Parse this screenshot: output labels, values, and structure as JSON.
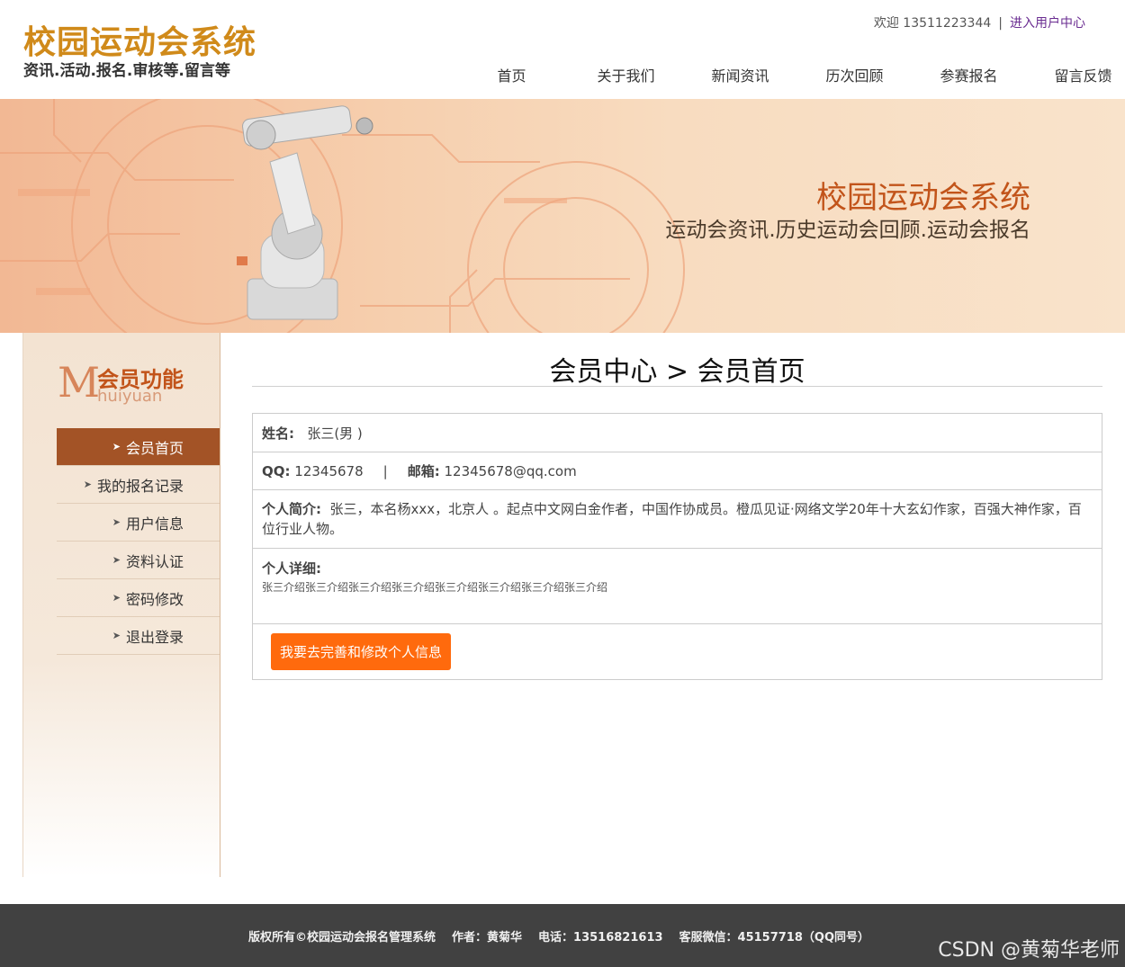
{
  "header": {
    "logo_title": "校园运动会系统",
    "logo_subtitle": "资讯.活动.报名.审核等.留言等",
    "welcome": "欢迎 13511223344",
    "separator": "|",
    "user_center_link": "进入用户中心",
    "nav": [
      "首页",
      "关于我们",
      "新闻资讯",
      "历次回顾",
      "参赛报名",
      "留言反馈"
    ]
  },
  "banner": {
    "title": "校园运动会系统",
    "subtitle": "运动会资讯.历史运动会回顾.运动会报名"
  },
  "sidebar": {
    "heading_letter": "M",
    "heading_cn": "会员功能",
    "heading_en": "huiyuan",
    "arrow_glyph": "➤",
    "items": [
      {
        "label": "会员首页",
        "active": true
      },
      {
        "label": "我的报名记录",
        "active": false
      },
      {
        "label": "用户信息",
        "active": false
      },
      {
        "label": "资料认证",
        "active": false
      },
      {
        "label": "密码修改",
        "active": false
      },
      {
        "label": "退出登录",
        "active": false
      }
    ]
  },
  "main": {
    "title": "会员中心 > 会员首页",
    "name_label": "姓名:",
    "name_value": "张三(男 )",
    "qq_label": "QQ:",
    "qq_value": "12345678",
    "qq_separator": "|",
    "email_label": "邮箱:",
    "email_value": "12345678@qq.com",
    "intro_label": "个人简介:",
    "intro_value": "张三，本名杨xxx，北京人 。起点中文网白金作者，中国作协成员。橙瓜见证·网络文学20年十大玄幻作家，百强大神作家，百位行业人物。",
    "detail_label": "个人详细:",
    "detail_value": "张三介绍张三介绍张三介绍张三介绍张三介绍张三介绍张三介绍张三介绍",
    "edit_button": "我要去完善和修改个人信息"
  },
  "footer": {
    "copyright": "版权所有©校园运动会报名管理系统",
    "author": "作者：黄菊华",
    "phone": "电话：13516821613",
    "wechat": "客服微信：45157718（QQ同号）"
  },
  "watermark": "CSDN @黄菊华老师",
  "colors": {
    "brand_gold": "#d08a1a",
    "banner_title": "#c2541a",
    "sidebar_active": "#a35326",
    "button_orange": "#ff6a0d",
    "footer_bg": "#414141"
  }
}
